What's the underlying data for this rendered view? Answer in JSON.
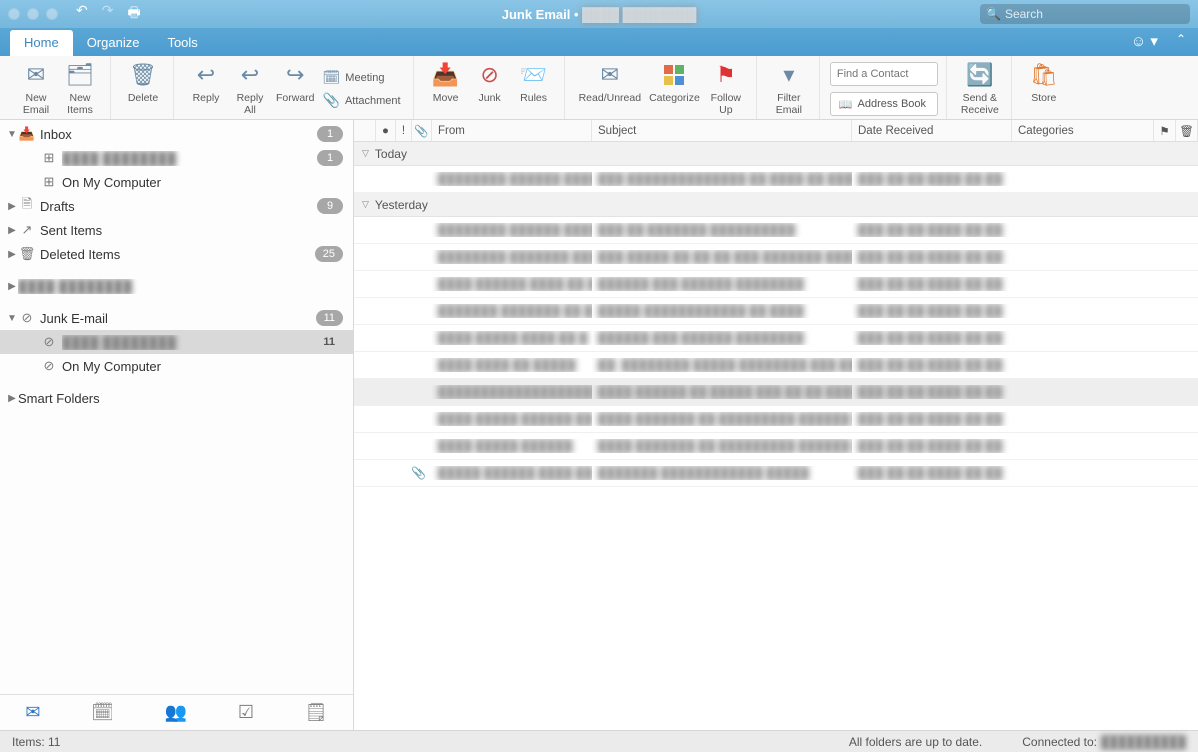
{
  "window": {
    "title_prefix": "Junk Email",
    "title_sep": " • ",
    "account_blur": "████ ████████"
  },
  "search": {
    "placeholder": "Search"
  },
  "tabs": {
    "home": "Home",
    "organize": "Organize",
    "tools": "Tools"
  },
  "ribbon": {
    "new_email": "New\nEmail",
    "new_items": "New\nItems",
    "delete": "Delete",
    "reply": "Reply",
    "reply_all": "Reply\nAll",
    "forward": "Forward",
    "meeting": "Meeting",
    "attachment": "Attachment",
    "move": "Move",
    "junk": "Junk",
    "rules": "Rules",
    "read_unread": "Read/Unread",
    "categorize": "Categorize",
    "follow_up": "Follow\nUp",
    "filter_email": "Filter\nEmail",
    "find_contact_ph": "Find a Contact",
    "address_book": "Address Book",
    "send_receive": "Send &\nReceive",
    "store": "Store"
  },
  "folders": {
    "inbox": "Inbox",
    "inbox_badge": "1",
    "inbox_sub_blur": "████ ████████",
    "inbox_sub_badge": "1",
    "on_my_computer": "On My Computer",
    "drafts": "Drafts",
    "drafts_badge": "9",
    "sent": "Sent Items",
    "deleted": "Deleted Items",
    "deleted_badge": "25",
    "account_blur": "████ ████████",
    "junk": "Junk E-mail",
    "junk_badge": "11",
    "junk_sub_blur": "████ ████████",
    "junk_sub_badge": "11",
    "junk_omc": "On My Computer",
    "smart": "Smart Folders"
  },
  "columns": {
    "from": "From",
    "subject": "Subject",
    "date": "Date Received",
    "categories": "Categories"
  },
  "groups": {
    "today": "Today",
    "yesterday": "Yesterday"
  },
  "messages": {
    "today": [
      {
        "from": "████████ ██████ ██████",
        "subject": "███ ██████████████ ██ ████ ██ ████████",
        "date": "███ ██/██/████ ██:██"
      }
    ],
    "yesterday": [
      {
        "from": "████████ ██████ ██████",
        "subject": "███ ██ ███████ ██████████",
        "date": "███ ██/██/████ ██:██"
      },
      {
        "from": "████████ ███████ ████",
        "subject": "███ █████ ██ ██ ██ ███ ███████ ██████",
        "date": "███ ██/██/████ ██:██"
      },
      {
        "from": "████ ██████ ████ ██ █",
        "subject": "██████ ███ ██████ ████████",
        "date": "███ ██/██/████ ██:██"
      },
      {
        "from": "███████ ███████ ██ ██",
        "subject": "█████ ████████████ ██ ████",
        "date": "███ ██/██/████ ██:██"
      },
      {
        "from": "████ █████ ████ ██ █",
        "subject": "██████ ███ ██████ ████████",
        "date": "███ ██/██/████ ██:██"
      },
      {
        "from": "████ ████ ██ █████",
        "subject": "██: ████████ █████ ████████ ███ ███████",
        "date": "███ ██/██/████ ██:██"
      },
      {
        "from": "███████████████████",
        "subject": "████ ██████ ██ █████ ███ ██ ██ ████",
        "date": "███ ██/██/████ ██:██",
        "selected": true
      },
      {
        "from": "████ █████ ██████ ██",
        "subject": "████ ███████ ██ █████████ ██████ ████",
        "date": "███ ██/██/████ ██:██"
      },
      {
        "from": "████ █████ ██████",
        "subject": "████ ███████ ██ █████████ ██████ ████",
        "date": "███ ██/██/████ ██:██"
      },
      {
        "from": "█████ ██████ ████ ██ █",
        "subject": "███████ ████████████ █████",
        "date": "███ ██/██/████ ██:██",
        "attachment": true
      }
    ]
  },
  "status": {
    "items": "Items: 11",
    "sync": "All folders are up to date.",
    "connected": "Connected to:",
    "connected_blur": "██████████"
  }
}
